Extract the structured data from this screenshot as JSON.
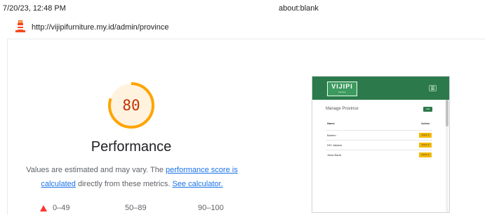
{
  "print_header": {
    "datetime": "7/20/23, 12:48 PM",
    "page_title": "about:blank"
  },
  "page": {
    "url": "http://vijipifurniture.my.id/admin/province",
    "site_icon": "lighthouse-icon"
  },
  "performance": {
    "score": "80",
    "score_fraction": 0.8,
    "title": "Performance",
    "desc_prefix": "Values are estimated and may vary. The ",
    "score_link": "performance score is calculated",
    "desc_middle": " directly from these metrics. ",
    "calculator_link": "See calculator.",
    "colors": {
      "gauge": "#ffa400",
      "gauge_bg": "#fff3e0",
      "score_text": "#c33300"
    }
  },
  "legend": {
    "fail_icon": "triangle-icon",
    "fail_color": "#ff3333",
    "fail": "0–49",
    "average": "50–89",
    "pass": "90–100"
  },
  "screenshot": {
    "logo": "VIJIPI",
    "logo_subtitle": "furniture",
    "heading": "Manage Province",
    "add_label": "Add",
    "col_name": "Name",
    "col_action": "Action",
    "rows": [
      {
        "name": "Banten",
        "action": "Action ▾"
      },
      {
        "name": "DKI Jakarta",
        "action": "Action ▾"
      },
      {
        "name": "Jawa Barat",
        "action": "Action ▾"
      }
    ],
    "colors": {
      "navbar": "#2c7a4b",
      "action_button": "#f2b705"
    }
  }
}
